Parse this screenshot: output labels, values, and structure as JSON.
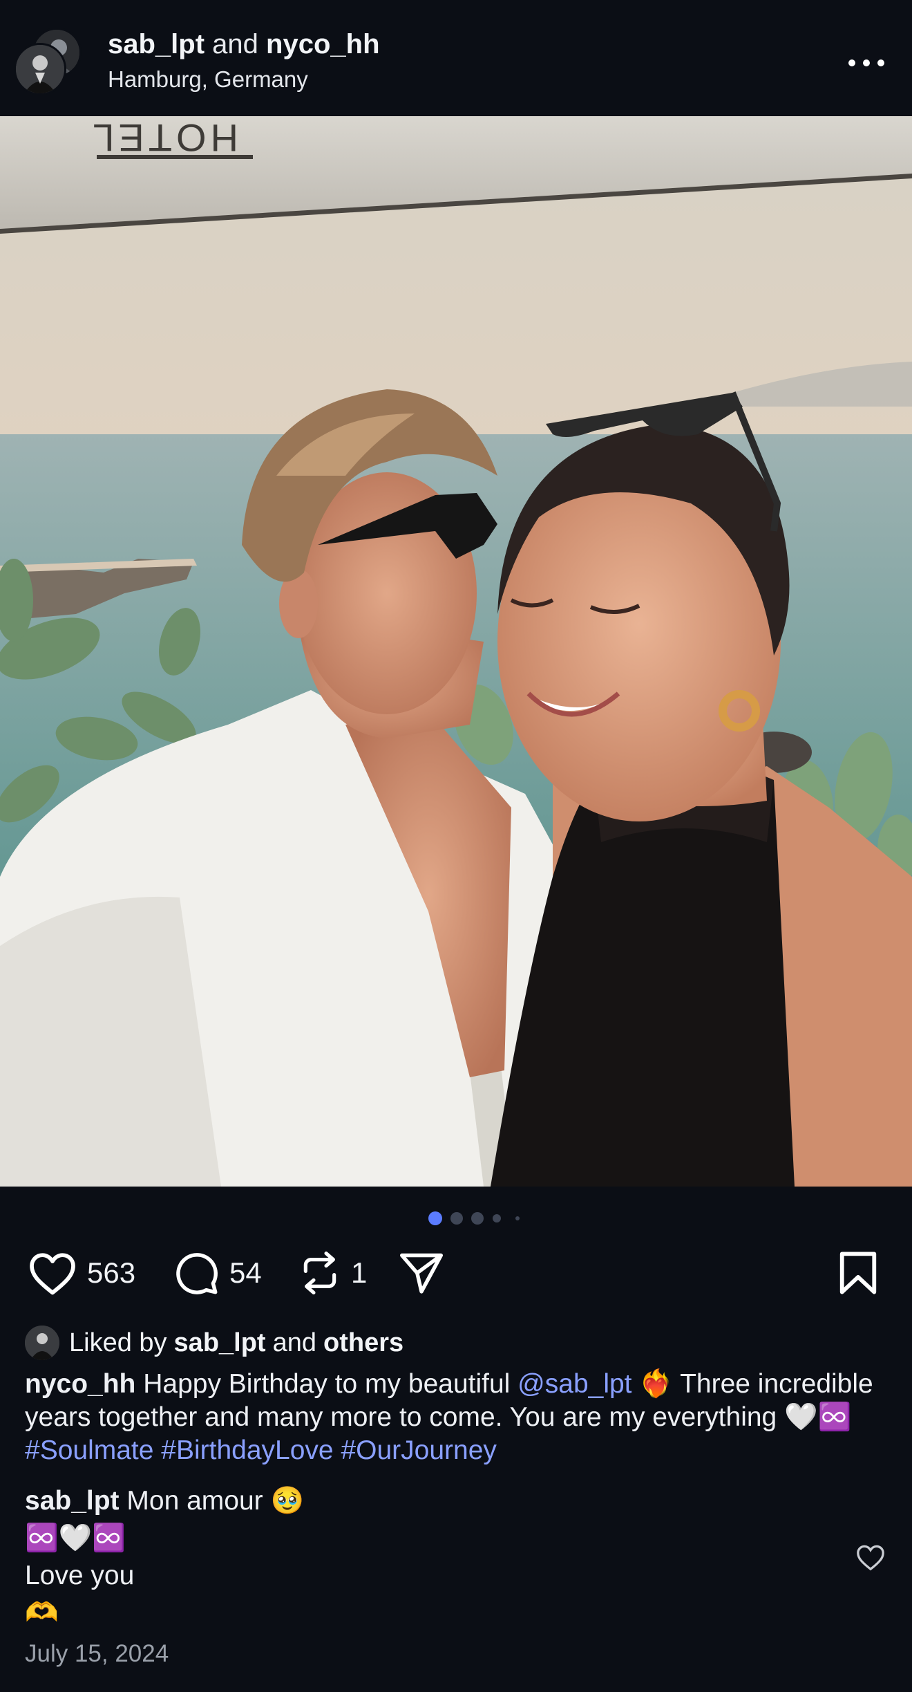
{
  "header": {
    "user1": "sab_lpt",
    "connector": "and",
    "user2": "nyco_hh",
    "location": "Hamburg, Germany",
    "more_icon": "more-horizontal-icon"
  },
  "photo": {
    "sign_text": "HOTEL"
  },
  "carousel": {
    "count": 5,
    "active_index": 0
  },
  "actions": {
    "likes": "563",
    "comments": "54",
    "reposts": "1",
    "like_icon": "heart-icon",
    "comment_icon": "comment-bubble-icon",
    "repost_icon": "repost-icon",
    "share_icon": "send-icon",
    "save_icon": "bookmark-icon"
  },
  "liked_by": {
    "prefix": "Liked by",
    "user": "sab_lpt",
    "connector": "and",
    "others": "others"
  },
  "caption": {
    "author": "nyco_hh",
    "text1": "Happy Birthday to my beautiful",
    "mention": "@sab_lpt",
    "emoji1": "❤️‍🔥",
    "text2": "Three incredible years together and many more to come. You are my everything",
    "emoji2": "🤍♾️",
    "hashtags": "#Soulmate #BirthdayLove #OurJourney"
  },
  "comment": {
    "author": "sab_lpt",
    "line1": "Mon amour",
    "emoji1": "🥹",
    "line2_emoji": "♾️🤍♾️",
    "line3": "Love you",
    "line4_emoji": "🫶"
  },
  "date": "July 15, 2024",
  "colors": {
    "background": "#0b0e15",
    "link": "#8aa0ff",
    "active_dot": "#5b7cff",
    "inactive_dot": "#3f4656",
    "muted_text": "#9aa0aa"
  }
}
